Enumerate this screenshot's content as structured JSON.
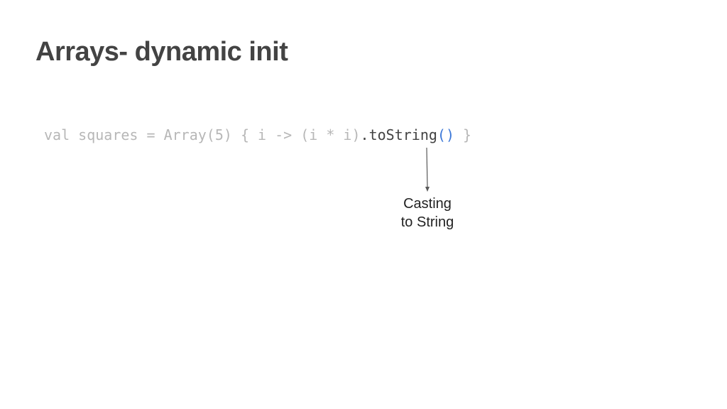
{
  "slide": {
    "title": "Arrays- dynamic init"
  },
  "code": {
    "prefix": "val squares = Array(5) { i -> (i * i)",
    "method": ".toString",
    "parens": "()",
    "suffix": " }"
  },
  "annotation": {
    "line1": "Casting",
    "line2": "to String"
  },
  "colors": {
    "title": "#434343",
    "code_dim": "#b7b7b7",
    "code_method": "#434343",
    "code_parens": "#3c78d8",
    "arrow": "#595959"
  }
}
